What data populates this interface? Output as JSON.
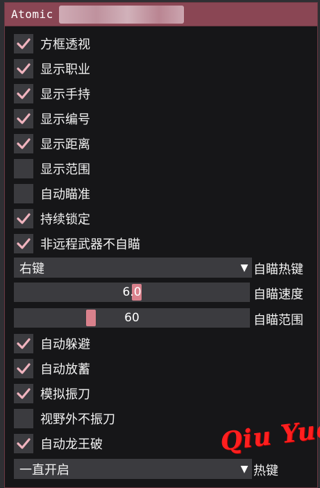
{
  "window": {
    "title": "Atomic"
  },
  "checkboxes_top": [
    {
      "label": "方框透视",
      "checked": true
    },
    {
      "label": "显示职业",
      "checked": true
    },
    {
      "label": "显示手持",
      "checked": true
    },
    {
      "label": "显示编号",
      "checked": true
    },
    {
      "label": "显示距离",
      "checked": true
    },
    {
      "label": "显示范围",
      "checked": false
    },
    {
      "label": "自动瞄准",
      "checked": false
    },
    {
      "label": "持续锁定",
      "checked": true
    },
    {
      "label": "非远程武器不自瞄",
      "checked": true
    }
  ],
  "aim_hotkey": {
    "value": "右键",
    "label": "自瞄热键",
    "arrow_icon": "triangle-down-icon"
  },
  "aim_speed": {
    "value": "6.0",
    "level": 0.52,
    "label": "自瞄速度"
  },
  "aim_range": {
    "value": "60",
    "level": 0.32,
    "label": "自瞄范围"
  },
  "checkboxes_bottom": [
    {
      "label": "自动躲避",
      "checked": true
    },
    {
      "label": "自动放蓄",
      "checked": true
    },
    {
      "label": "模拟振刀",
      "checked": true
    },
    {
      "label": "视野外不振刀",
      "checked": false
    },
    {
      "label": "自动龙王破",
      "checked": true
    }
  ],
  "hotkey": {
    "value": "一直开启",
    "label": "热键",
    "arrow_icon": "triangle-down-icon"
  },
  "watermark": {
    "text": "Qiu Yue",
    "color": "#ff1f1f"
  },
  "colors": {
    "accent": "#8a4654",
    "check": "#f0b4bf",
    "grab": "#d9818c",
    "frame": "#3b3b3f"
  }
}
